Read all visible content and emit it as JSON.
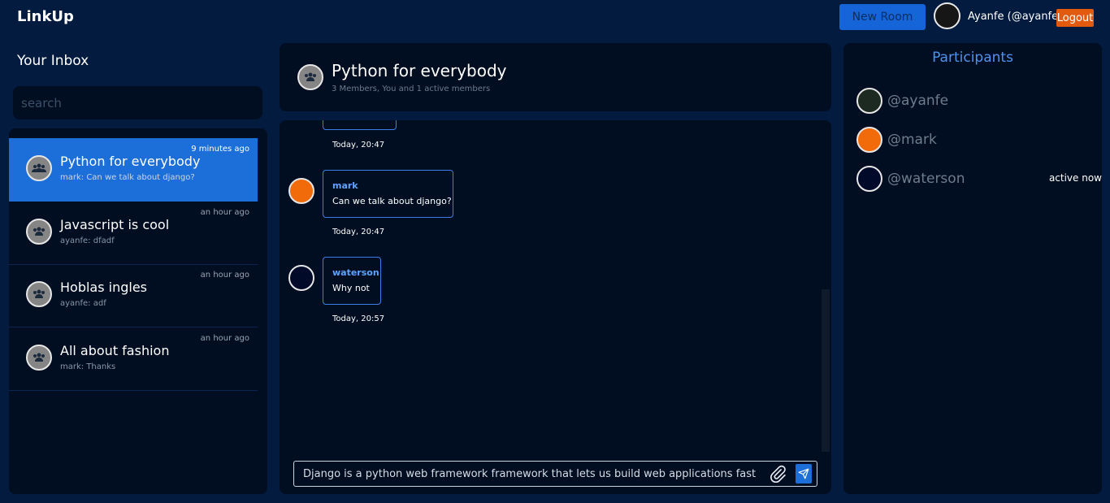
{
  "app": {
    "brand": "LinkUp",
    "new_room_label": "New Room",
    "username": "Ayanfe (@ayanfe)",
    "logout_label": "Logout"
  },
  "inbox": {
    "title": "Your Inbox",
    "search_placeholder": "search",
    "items": [
      {
        "name": "Python for everybody",
        "last": "mark: Can we talk about django?",
        "time": "9 minutes ago",
        "active": true
      },
      {
        "name": "Javascript is cool",
        "last": "ayanfe: dfadf",
        "time": "an hour ago"
      },
      {
        "name": "Hoblas ingles",
        "last": "ayanfe: adf",
        "time": "an hour ago"
      },
      {
        "name": "All about fashion",
        "last": "mark: Thanks",
        "time": "an hour ago"
      }
    ]
  },
  "chat": {
    "title": "Python for everybody",
    "subtitle": "3 Members, You and 1 active members",
    "messages": [
      {
        "author": "",
        "text": "",
        "time": "Today, 20:47"
      },
      {
        "author": "mark",
        "text": "Can we talk about django?",
        "time": "Today, 20:47"
      },
      {
        "author": "waterson",
        "text": "Why not",
        "time": "Today, 20:57"
      }
    ],
    "composer_value": "Django is a python web framework framework that lets us build web applications fast"
  },
  "participants": {
    "title": "Participants",
    "items": [
      {
        "handle": "@ayanfe",
        "status": ""
      },
      {
        "handle": "@mark",
        "status": ""
      },
      {
        "handle": "@waterson",
        "status": "active now"
      }
    ]
  },
  "colors": {
    "background": "#021b3f",
    "panel": "#010d21",
    "accent": "#1c6fd8",
    "logout": "#e25a0e",
    "mark_avatar": "#f26b0a"
  },
  "icons": [
    "group-icon",
    "paperclip-icon",
    "send-icon"
  ]
}
